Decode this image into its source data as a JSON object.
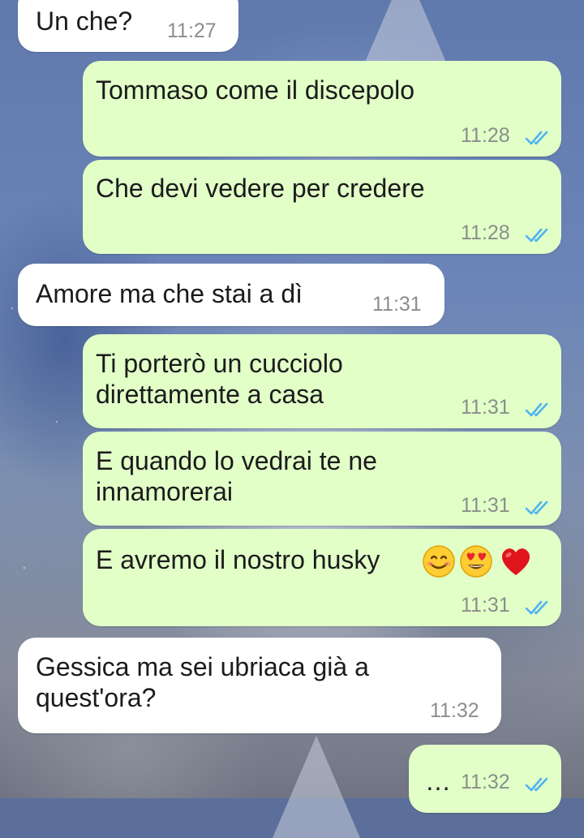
{
  "chat": {
    "messages": [
      {
        "direction": "incoming",
        "text": "Un che?",
        "time": "11:27"
      },
      {
        "direction": "outgoing",
        "text": "Tommaso come il discepolo",
        "time": "11:28",
        "status": "read"
      },
      {
        "direction": "outgoing",
        "text": "Che devi vedere per credere",
        "time": "11:28",
        "status": "read"
      },
      {
        "direction": "incoming",
        "text": "Amore ma che stai a dì",
        "time": "11:31"
      },
      {
        "direction": "outgoing",
        "text": "Ti porterò un cucciolo\ndirettamente a casa",
        "time": "11:31",
        "status": "read"
      },
      {
        "direction": "outgoing",
        "text": "E quando lo vedrai te ne\ninnamorerai",
        "time": "11:31",
        "status": "read"
      },
      {
        "direction": "outgoing",
        "text": "E avremo il nostro husky",
        "emojis": [
          "smiling-face-emoji",
          "heart-eyes-emoji",
          "red-heart-emoji"
        ],
        "time": "11:31",
        "status": "read"
      },
      {
        "direction": "incoming",
        "text": "Gessica ma sei ubriaca già a\nquest'ora?",
        "time": "11:32"
      },
      {
        "direction": "outgoing",
        "text": "…",
        "time": "11:32",
        "status": "read"
      }
    ]
  },
  "colors": {
    "incoming_bubble": "#ffffff",
    "outgoing_bubble": "#e2ffc8",
    "timestamp": "#8a8f8a",
    "read_ticks": "#4fb3f0"
  },
  "icons": {
    "read_receipt": "double-check-icon"
  }
}
